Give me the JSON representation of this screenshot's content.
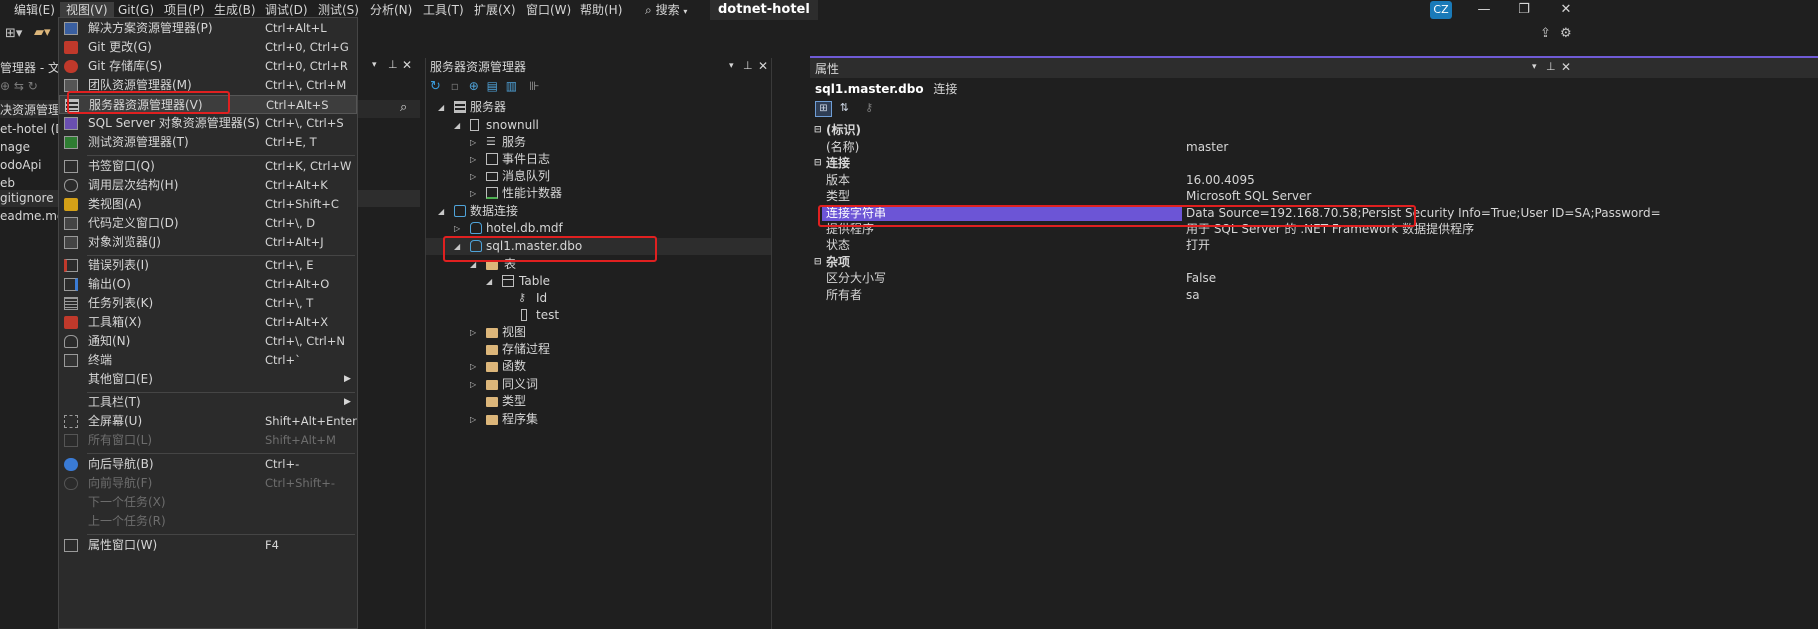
{
  "menubar": {
    "items": [
      "编辑(E)",
      "视图(V)",
      "Git(G)",
      "项目(P)",
      "生成(B)",
      "调试(D)",
      "测试(S)",
      "分析(N)",
      "工具(T)",
      "扩展(X)",
      "窗口(W)",
      "帮助(H)"
    ],
    "search_label": "搜索",
    "solution_name": "dotnet-hotel",
    "avatar": "CZ"
  },
  "solution_explorer": {
    "title": "管理器 - 文件",
    "search_label": "决资源管理器",
    "items": [
      "et-hotel (D:",
      "nage",
      "odoApi",
      "eb",
      "gitignore",
      "eadme.md"
    ]
  },
  "view_menu": {
    "items": [
      {
        "label": "解决方案资源管理器(P)",
        "shortcut": "Ctrl+Alt+L",
        "icon": "solution-explorer-icon"
      },
      {
        "label": "Git 更改(G)",
        "shortcut": "Ctrl+0, Ctrl+G",
        "icon": "git-changes-icon"
      },
      {
        "label": "Git 存储库(S)",
        "shortcut": "Ctrl+0, Ctrl+R",
        "icon": "git-repository-icon"
      },
      {
        "label": "团队资源管理器(M)",
        "shortcut": "Ctrl+\\, Ctrl+M",
        "icon": "team-explorer-icon"
      },
      {
        "label": "服务器资源管理器(V)",
        "shortcut": "Ctrl+Alt+S",
        "icon": "server-explorer-icon"
      },
      {
        "label": "SQL Server 对象资源管理器(S)",
        "shortcut": "Ctrl+\\, Ctrl+S",
        "icon": "sql-object-explorer-icon"
      },
      {
        "label": "测试资源管理器(T)",
        "shortcut": "Ctrl+E, T",
        "icon": "test-explorer-icon"
      },
      {
        "label": "书签窗口(Q)",
        "shortcut": "Ctrl+K, Ctrl+W",
        "icon": "bookmark-icon"
      },
      {
        "label": "调用层次结构(H)",
        "shortcut": "Ctrl+Alt+K",
        "icon": "call-hierarchy-icon"
      },
      {
        "label": "类视图(A)",
        "shortcut": "Ctrl+Shift+C",
        "icon": "class-view-icon"
      },
      {
        "label": "代码定义窗口(D)",
        "shortcut": "Ctrl+\\, D",
        "icon": "code-definition-icon"
      },
      {
        "label": "对象浏览器(J)",
        "shortcut": "Ctrl+Alt+J",
        "icon": "object-browser-icon"
      },
      {
        "label": "错误列表(I)",
        "shortcut": "Ctrl+\\, E",
        "icon": "error-list-icon"
      },
      {
        "label": "输出(O)",
        "shortcut": "Ctrl+Alt+O",
        "icon": "output-icon"
      },
      {
        "label": "任务列表(K)",
        "shortcut": "Ctrl+\\, T",
        "icon": "task-list-icon"
      },
      {
        "label": "工具箱(X)",
        "shortcut": "Ctrl+Alt+X",
        "icon": "toolbox-icon"
      },
      {
        "label": "通知(N)",
        "shortcut": "Ctrl+\\, Ctrl+N",
        "icon": "notification-bell-icon"
      },
      {
        "label": "终端",
        "shortcut": "Ctrl+`",
        "icon": "terminal-icon"
      },
      {
        "label": "其他窗口(E)",
        "shortcut": "",
        "icon": ""
      },
      {
        "label": "工具栏(T)",
        "shortcut": "",
        "icon": ""
      },
      {
        "label": "全屏幕(U)",
        "shortcut": "Shift+Alt+Enter",
        "icon": "fullscreen-icon"
      },
      {
        "label": "所有窗口(L)",
        "shortcut": "Shift+Alt+M",
        "icon": "all-windows-icon"
      },
      {
        "label": "向后导航(B)",
        "shortcut": "Ctrl+-",
        "icon": "navigate-back-icon"
      },
      {
        "label": "向前导航(F)",
        "shortcut": "Ctrl+Shift+-",
        "icon": "navigate-forward-icon"
      },
      {
        "label": "下一个任务(X)",
        "shortcut": "",
        "icon": ""
      },
      {
        "label": "上一个任务(R)",
        "shortcut": "",
        "icon": ""
      },
      {
        "label": "属性窗口(W)",
        "shortcut": "F4",
        "icon": "properties-window-icon"
      }
    ]
  },
  "server_explorer": {
    "title": "服务器资源管理器",
    "tree": [
      {
        "label": "服务器"
      },
      {
        "label": "snownull"
      },
      {
        "label": "服务"
      },
      {
        "label": "事件日志"
      },
      {
        "label": "消息队列"
      },
      {
        "label": "性能计数器"
      },
      {
        "label": "数据连接"
      },
      {
        "label": "hotel.db.mdf"
      },
      {
        "label": "sql1.master.dbo"
      },
      {
        "label": "表"
      },
      {
        "label": "Table"
      },
      {
        "label": "Id"
      },
      {
        "label": "test"
      },
      {
        "label": "视图"
      },
      {
        "label": "存储过程"
      },
      {
        "label": "函数"
      },
      {
        "label": "同义词"
      },
      {
        "label": "类型"
      },
      {
        "label": "程序集"
      }
    ]
  },
  "properties": {
    "title": "属性",
    "object_name": "sql1.master.dbo",
    "object_type": "连接",
    "rows": [
      {
        "name": "(标识)",
        "value": "",
        "category": true
      },
      {
        "name": "(名称)",
        "value": "master"
      },
      {
        "name": "连接",
        "value": "",
        "category": true
      },
      {
        "name": "版本",
        "value": "16.00.4095"
      },
      {
        "name": "类型",
        "value": "Microsoft SQL Server"
      },
      {
        "name": "连接字符串",
        "value": "Data Source=192.168.70.58;Persist Security Info=True;User ID=SA;Password=",
        "selected": true
      },
      {
        "name": "提供程序",
        "value": "用于 SQL Server 的 .NET Framework 数据提供程序"
      },
      {
        "name": "状态",
        "value": "打开"
      },
      {
        "name": "杂项",
        "value": "",
        "category": true
      },
      {
        "name": "区分大小写",
        "value": "False"
      },
      {
        "name": "所有者",
        "value": "sa"
      }
    ]
  },
  "colors": {
    "accent": "#6f5bd6",
    "selected_row": "#6c55d6",
    "annotation_red": "#e02020",
    "folder": "#dcb67a",
    "menu_bg": "#2b2b2b"
  }
}
